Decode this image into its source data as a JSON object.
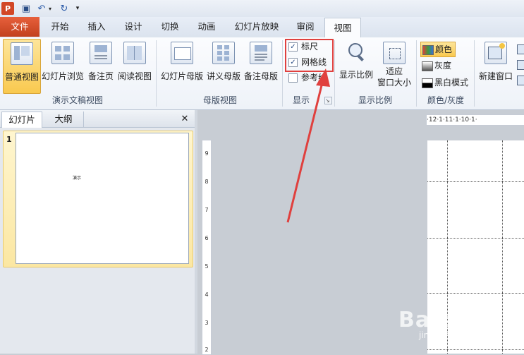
{
  "tabs": [
    "文件",
    "开始",
    "插入",
    "设计",
    "切换",
    "动画",
    "幻灯片放映",
    "审阅",
    "视图"
  ],
  "ribbon": {
    "presentation_views": {
      "buttons": [
        "普通视图",
        "幻灯片浏览",
        "备注页",
        "阅读视图"
      ],
      "label": "演示文稿视图"
    },
    "master_views": {
      "buttons": [
        "幻灯片母版",
        "讲义母版",
        "备注母版"
      ],
      "label": "母版视图"
    },
    "show": {
      "ruler": "标尺",
      "ruler_checked": true,
      "gridlines": "网格线",
      "gridlines_checked": true,
      "guides": "参考线",
      "guides_checked": false,
      "label": "显示"
    },
    "zoom": {
      "zoom": "显示比例",
      "fit_line1": "适应",
      "fit_line2": "窗口大小",
      "label": "显示比例"
    },
    "color": {
      "color": "颜色",
      "grayscale": "灰度",
      "bw": "黑白模式",
      "label": "颜色/灰度"
    },
    "window": {
      "new_window": "新建窗口"
    }
  },
  "pane": {
    "tab_slides": "幻灯片",
    "tab_outline": "大纲",
    "close": "✕",
    "slide_number": "1",
    "thumb_text": "演示"
  },
  "ruler": {
    "h_text": "·12·1·11·1·10·1·",
    "v_labels": [
      "9",
      "8",
      "7",
      "6",
      "5",
      "4",
      "3",
      "2"
    ]
  },
  "watermark": {
    "brand": "Bai 经验",
    "url": "jingyan.baidu.com"
  },
  "colors": {
    "accent_file": "#d4502b",
    "annotation_red": "#e0403e"
  }
}
